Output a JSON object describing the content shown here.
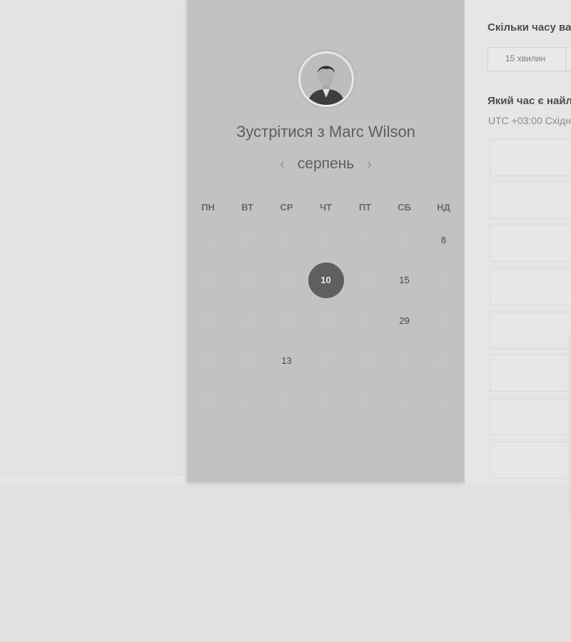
{
  "scheduler": {
    "title": "Зустрітися з Marc Wilson",
    "month": "серпень",
    "weekdays": [
      "ПН",
      "ВТ",
      "СР",
      "ЧТ",
      "ПТ",
      "СБ",
      "НД"
    ],
    "weeks": [
      [
        "1",
        "2",
        "3",
        "4",
        "5",
        "6",
        "8"
      ],
      [
        "10",
        "11",
        "12",
        "10",
        "14",
        "15",
        "16"
      ],
      [
        "17",
        "18",
        "19",
        "20",
        "21",
        "29",
        "23"
      ],
      [
        "24",
        "25",
        "13",
        "27",
        "28",
        "29",
        "30"
      ],
      [
        "31",
        "1",
        "2",
        "3",
        "4",
        "5",
        "6"
      ]
    ],
    "available": [
      "8",
      "15",
      "29",
      "13"
    ],
    "selected": "10"
  },
  "duration": {
    "question": "Скільки часу ва",
    "option": "15 хвилин"
  },
  "time_question": "Який час є найл",
  "timezone": "UTC +03:00 Східн"
}
